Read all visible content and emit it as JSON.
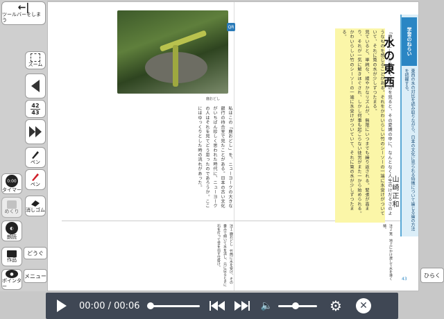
{
  "toolbar": {
    "hide_label": "ツールバーをしまう",
    "zoom_label": "ズーム",
    "page_current": "42",
    "page_next": "43",
    "pen_label": "ペン",
    "pen2_label": "ペン",
    "eraser_label": "消しゴム",
    "timer_label": "タイマー",
    "mekuri_label": "めくり",
    "read_label": "朗読",
    "sakuhin_label": "作品",
    "dougu_label": "どうぐ",
    "menu_label": "メニュー",
    "pointer_label": "ポインター"
  },
  "book": {
    "title": "水の東西",
    "author": "山崎正和",
    "aim_label": "学習のねらい",
    "aim_text": "東西の水の対比を読み取りながら、日本の文化に見られる特徴について論じる論の方法を把握する。",
    "photo_caption": "鹿おどし",
    "qr_label": "QR",
    "page_number": "43",
    "left_body": "私はこの「鹿おどし」を、ニューヨークの大きな銀行の待合室で見たことがある。日本の古い文化がいちばん珍しく思われた時代に、ニューヨークの人はそれを見てどう思ったのであろうか。ここにはゆっくりとした時の流れがあった。",
    "left_notes": "注１ 鹿おどし　竹筒に水を受け、その重みで傾いて水を流し、元に戻るときに石を打って音を出す仕掛け。",
    "right_body": "見ていると、単純な、緩やかなリズムが、無限にいつまでも繰り返される。緊張が高まり、それが一気に解きほぐされ、しかし何事も起こらない徒労がまた一から始められる。かわいらしい竹のシーソーの一端に水受けがついていて、それに筧の水が少しずつたまる。",
    "highlight_text": "「鹿おどし」が動いているのを見ると、その愛嬌の中に、なんとなく人生のけだるさのようなものを感じることがある。それをかわいらしい竹のシーソーの一端に水受けがついていて、それに筧の水が少しずつたまる。",
    "right_notes": "注２ 筧　地上にかけ渡して水を導く樋。"
  },
  "side": {
    "open_label": "ひらく"
  },
  "player": {
    "time": "00:00 / 00:06"
  },
  "icons": {
    "play": "play-icon",
    "rewind": "skip-back-icon",
    "forward": "skip-forward-icon",
    "volume": "volume-icon",
    "settings": "gear-icon",
    "close": "close-icon"
  }
}
